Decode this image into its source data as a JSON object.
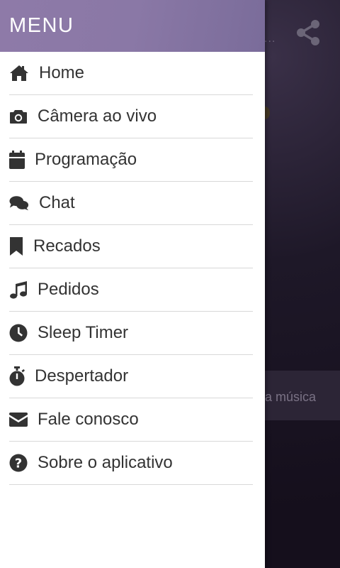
{
  "background": {
    "dots": "...",
    "now_playing_text": "a música"
  },
  "drawer": {
    "title": "MENU",
    "items": [
      {
        "label": "Home",
        "icon": "home-icon"
      },
      {
        "label": "Câmera ao vivo",
        "icon": "camera-icon"
      },
      {
        "label": "Programação",
        "icon": "calendar-icon"
      },
      {
        "label": "Chat",
        "icon": "chat-icon"
      },
      {
        "label": "Recados",
        "icon": "bookmark-icon"
      },
      {
        "label": "Pedidos",
        "icon": "music-note-icon"
      },
      {
        "label": "Sleep Timer",
        "icon": "clock-icon"
      },
      {
        "label": "Despertador",
        "icon": "stopwatch-icon"
      },
      {
        "label": "Fale conosco",
        "icon": "envelope-icon"
      },
      {
        "label": "Sobre o aplicativo",
        "icon": "question-circle-icon"
      }
    ]
  },
  "colors": {
    "header_start": "#8e7aa8",
    "header_end": "#7a6c9a",
    "text": "#333333",
    "divider": "#d8d8d8"
  }
}
